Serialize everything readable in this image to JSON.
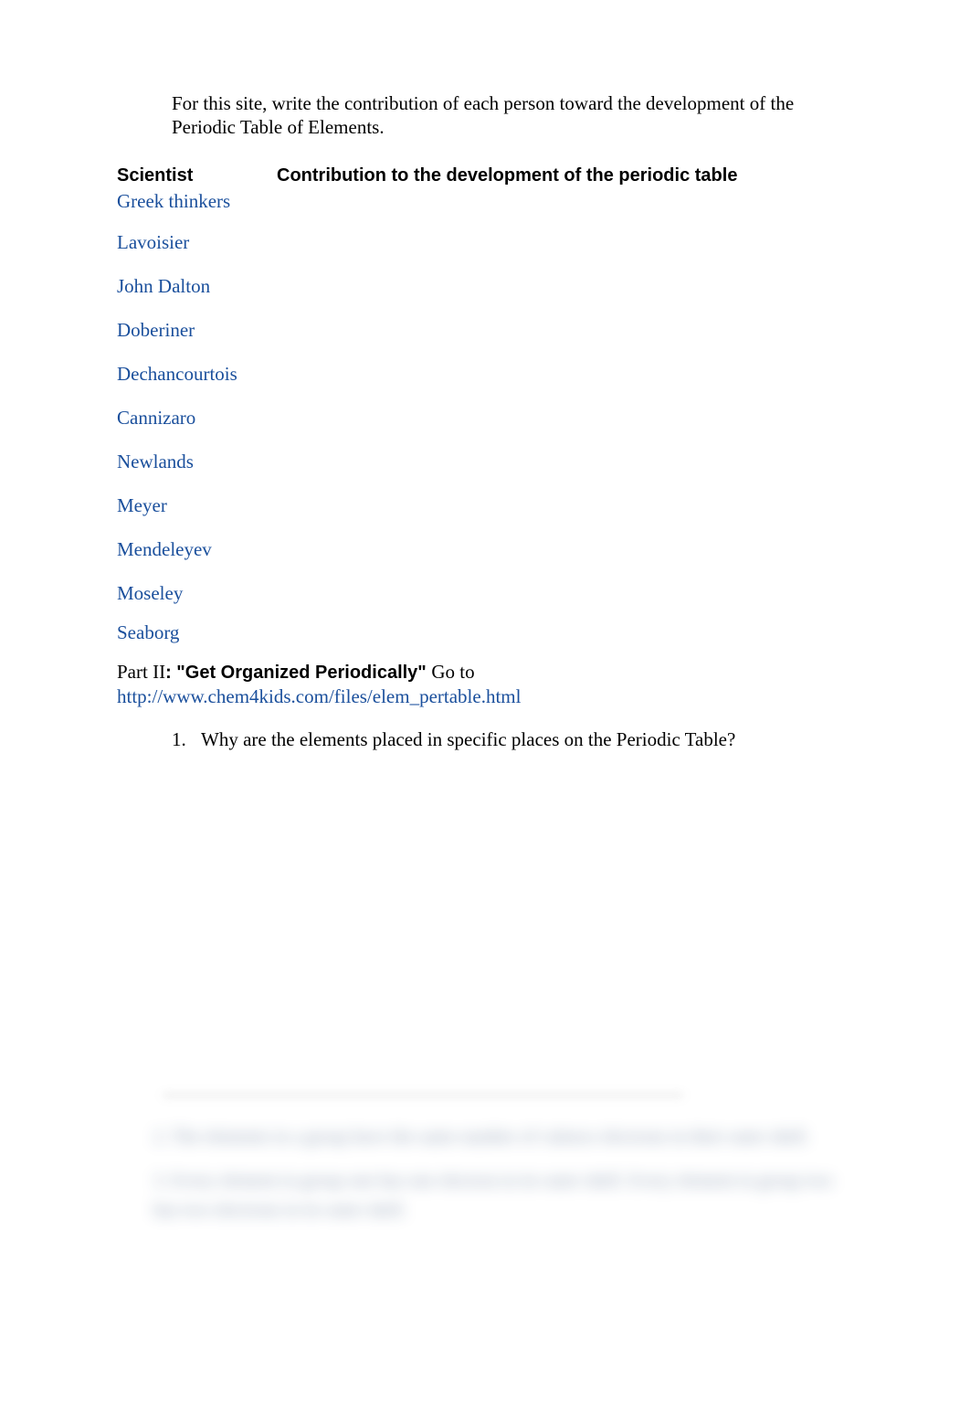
{
  "intro": "For this site, write the contribution of each person toward the development of the Periodic Table of Elements.",
  "table": {
    "header_col1": "Scientist",
    "header_col2": "Contribution to the development of the periodic table",
    "scientists": [
      "Greek thinkers",
      "Lavoisier",
      "John Dalton",
      "Doberiner",
      "Dechancourtois",
      "Cannizaro",
      "Newlands",
      "Meyer",
      "Mendeleyev",
      "Moseley",
      "Seaborg"
    ]
  },
  "part2": {
    "label": "Part II",
    "title": ": \"Get Organized Periodically\" ",
    "goto": "Go to",
    "link": "http://www.chem4kids.com/files/elem_pertable.html"
  },
  "questions": {
    "q1_num": "1.",
    "q1_text": "Why are the elements placed in specific places on the Periodic Table?"
  },
  "blurred": {
    "line1": "2.  The elements in a group have the same number of valence electrons in their outer shell.",
    "line2": "3.  Every element in group one has one electron in its outer shell.  Every element in group two has two electrons in its outer shell."
  }
}
